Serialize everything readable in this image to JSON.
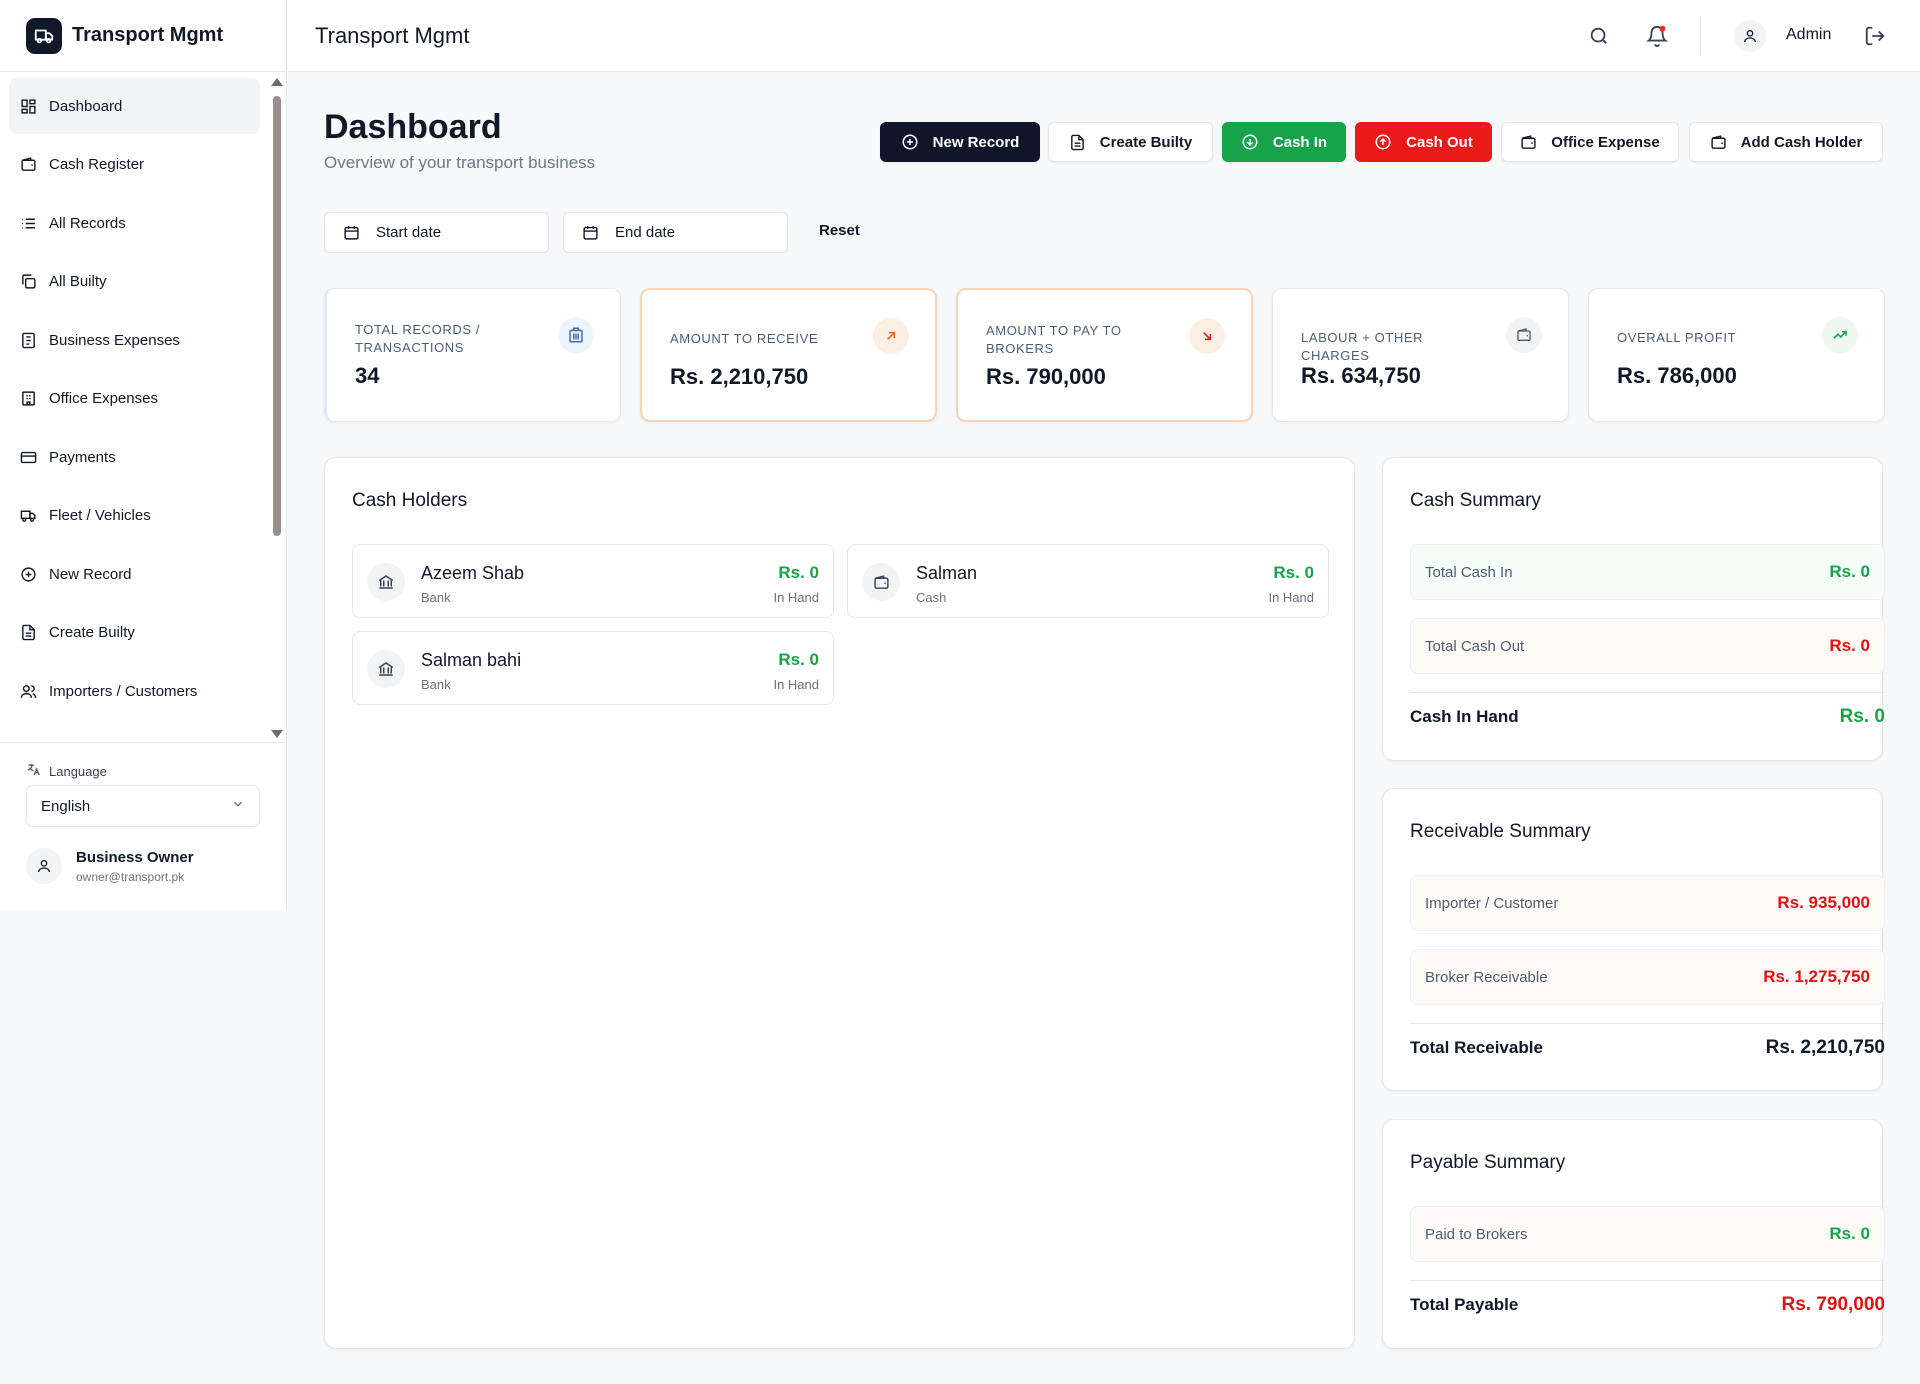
{
  "app": {
    "title": "Transport Mgmt"
  },
  "sidebar": {
    "items": [
      {
        "label": "Dashboard",
        "icon": "dashboard-icon"
      },
      {
        "label": "Cash Register",
        "icon": "wallet-icon"
      },
      {
        "label": "All Records",
        "icon": "list-icon"
      },
      {
        "label": "All Builty",
        "icon": "copy-icon"
      },
      {
        "label": "Business Expenses",
        "icon": "receipt-icon"
      },
      {
        "label": "Office Expenses",
        "icon": "building-icon"
      },
      {
        "label": "Payments",
        "icon": "credit-card-icon"
      },
      {
        "label": "Fleet / Vehicles",
        "icon": "truck-icon"
      },
      {
        "label": "New Record",
        "icon": "plus-circle-icon"
      },
      {
        "label": "Create Builty",
        "icon": "file-text-icon"
      },
      {
        "label": "Importers / Customers",
        "icon": "users-icon"
      }
    ],
    "language": {
      "label": "Language",
      "value": "English"
    },
    "user": {
      "name": "Business Owner",
      "email": "owner@transport.pk"
    }
  },
  "topbar": {
    "title": "Transport Mgmt",
    "user": "Admin"
  },
  "page": {
    "title": "Dashboard",
    "subtitle": "Overview of your transport business",
    "actions": {
      "new_record": "New Record",
      "create_builty": "Create Builty",
      "cash_in": "Cash In",
      "cash_out": "Cash Out",
      "office_expense": "Office Expense",
      "add_cash_holder": "Add Cash Holder"
    },
    "filters": {
      "start": "Start date",
      "end": "End date",
      "reset": "Reset"
    }
  },
  "stats": [
    {
      "label": "TOTAL RECORDS / TRANSACTIONS",
      "value": "34"
    },
    {
      "label": "AMOUNT TO RECEIVE",
      "value": "Rs. 2,210,750"
    },
    {
      "label": "AMOUNT TO PAY TO BROKERS",
      "value": "Rs. 790,000"
    },
    {
      "label": "LABOUR + OTHER CHARGES",
      "value": "Rs. 634,750"
    },
    {
      "label": "OVERALL PROFIT",
      "value": "Rs. 786,000"
    }
  ],
  "cash_holders": {
    "title": "Cash Holders",
    "items": [
      {
        "name": "Azeem Shab",
        "type": "Bank",
        "amount": "Rs. 0",
        "status": "In Hand"
      },
      {
        "name": "Salman",
        "type": "Cash",
        "amount": "Rs. 0",
        "status": "In Hand"
      },
      {
        "name": "Salman bahi",
        "type": "Bank",
        "amount": "Rs. 0",
        "status": "In Hand"
      }
    ]
  },
  "cash_summary": {
    "title": "Cash Summary",
    "total_in": {
      "label": "Total Cash In",
      "value": "Rs. 0"
    },
    "total_out": {
      "label": "Total Cash Out",
      "value": "Rs. 0"
    },
    "in_hand": {
      "label": "Cash In Hand",
      "value": "Rs. 0"
    }
  },
  "receivable_summary": {
    "title": "Receivable Summary",
    "importer": {
      "label": "Importer / Customer",
      "value": "Rs. 935,000"
    },
    "broker": {
      "label": "Broker Receivable",
      "value": "Rs. 1,275,750"
    },
    "total": {
      "label": "Total Receivable",
      "value": "Rs. 2,210,750"
    }
  },
  "payable_summary": {
    "title": "Payable Summary",
    "paid": {
      "label": "Paid to Brokers",
      "value": "Rs. 0"
    },
    "total": {
      "label": "Total Payable",
      "value": "Rs. 790,000"
    }
  },
  "colors": {
    "green": "#16a34a",
    "red": "#dc1414",
    "dark": "#0f1628"
  }
}
